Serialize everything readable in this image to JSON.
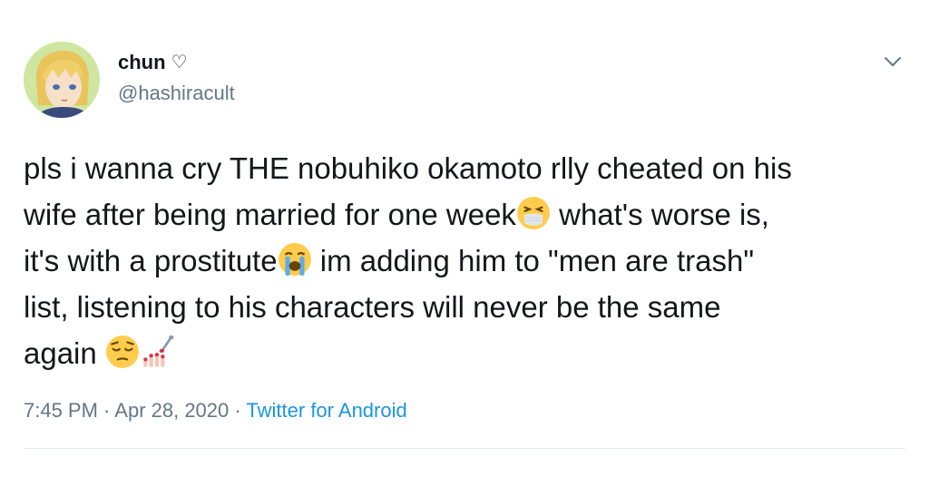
{
  "author": {
    "display_name": "chun",
    "name_symbol": "♡",
    "handle": "@hashiracult"
  },
  "tweet": {
    "lines": [
      "pls i wanna cry THE nobuhiko okamoto rlly cheated on his",
      [
        "wife after being married for one week",
        " what's worse is,"
      ],
      [
        "it's with a prostitute",
        " im adding him to \"men are trash\""
      ],
      "list, listening to his characters will never be the same",
      [
        "again ",
        ""
      ]
    ],
    "emojis": [
      "face-with-medical-mask-squint-icon",
      "crying-face-icon",
      "pensive-face-icon",
      "nail-polish-icon"
    ]
  },
  "meta": {
    "time": "7:45 PM",
    "separator": " · ",
    "date": "Apr 28, 2020",
    "source": "Twitter for Android"
  },
  "colors": {
    "text": "#14171a",
    "secondary": "#657786",
    "link": "#1b95e0",
    "divider": "#e6ecf0"
  }
}
